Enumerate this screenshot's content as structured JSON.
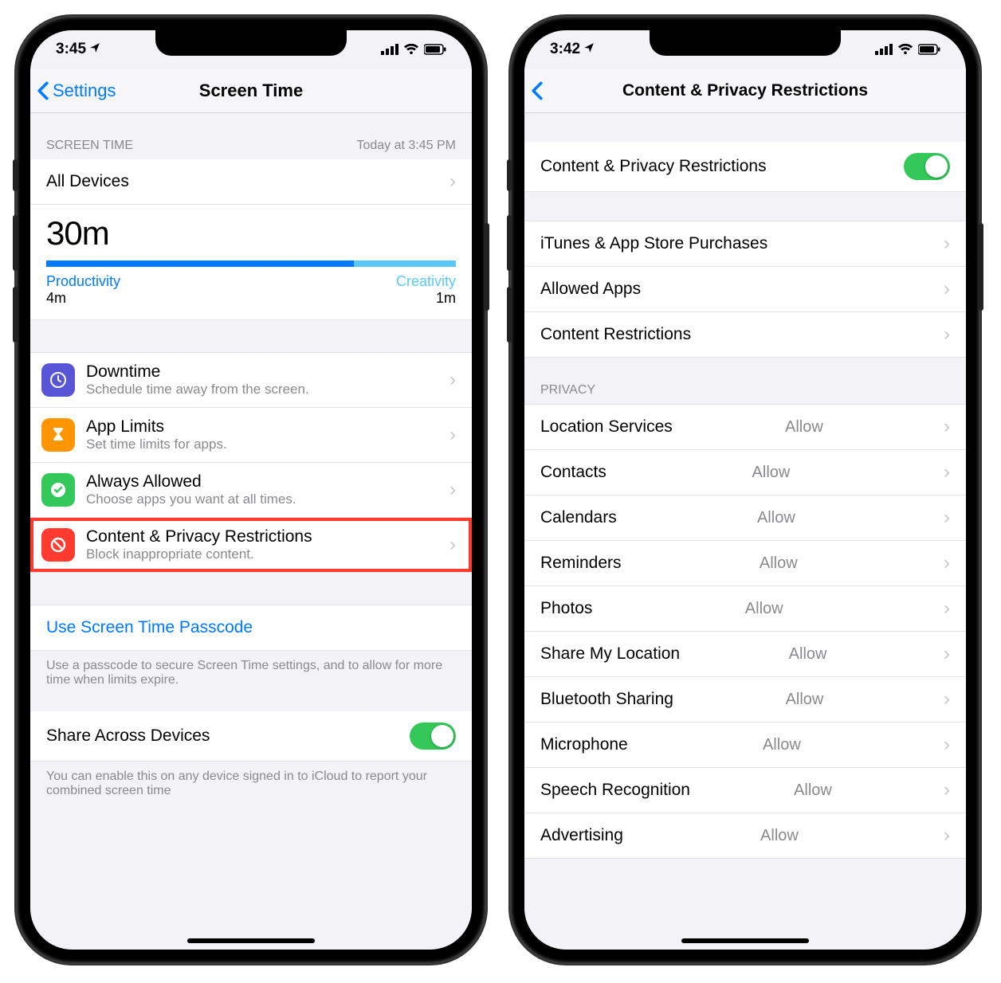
{
  "left": {
    "status": {
      "time": "3:45"
    },
    "nav": {
      "back": "Settings",
      "title": "Screen Time"
    },
    "summary": {
      "header_left": "Screen Time",
      "header_right": "Today at 3:45 PM",
      "all_devices": "All Devices",
      "total_time": "30m",
      "cat1_name": "Productivity",
      "cat1_value": "4m",
      "cat2_name": "Creativity",
      "cat2_value": "1m"
    },
    "features": [
      {
        "title": "Downtime",
        "subtitle": "Schedule time away from the screen.",
        "color": "#5856d6",
        "icon": "clock"
      },
      {
        "title": "App Limits",
        "subtitle": "Set time limits for apps.",
        "color": "#ff9500",
        "icon": "hourglass"
      },
      {
        "title": "Always Allowed",
        "subtitle": "Choose apps you want at all times.",
        "color": "#34c759",
        "icon": "check"
      },
      {
        "title": "Content & Privacy Restrictions",
        "subtitle": "Block inappropriate content.",
        "color": "#ff3b30",
        "icon": "block",
        "highlight": true
      }
    ],
    "passcode": {
      "link": "Use Screen Time Passcode",
      "help": "Use a passcode to secure Screen Time settings, and to allow for more time when limits expire."
    },
    "share": {
      "label": "Share Across Devices",
      "toggle_on": true,
      "help": "You can enable this on any device signed in to iCloud to report your combined screen time"
    }
  },
  "right": {
    "status": {
      "time": "3:42"
    },
    "nav": {
      "title": "Content & Privacy Restrictions"
    },
    "main_toggle": {
      "label": "Content & Privacy Restrictions",
      "on": true
    },
    "group1": [
      "iTunes & App Store Purchases",
      "Allowed Apps",
      "Content Restrictions"
    ],
    "privacy_header": "Privacy",
    "privacy": [
      {
        "label": "Location Services",
        "value": "Allow"
      },
      {
        "label": "Contacts",
        "value": "Allow"
      },
      {
        "label": "Calendars",
        "value": "Allow"
      },
      {
        "label": "Reminders",
        "value": "Allow"
      },
      {
        "label": "Photos",
        "value": "Allow"
      },
      {
        "label": "Share My Location",
        "value": "Allow"
      },
      {
        "label": "Bluetooth Sharing",
        "value": "Allow"
      },
      {
        "label": "Microphone",
        "value": "Allow"
      },
      {
        "label": "Speech Recognition",
        "value": "Allow"
      },
      {
        "label": "Advertising",
        "value": "Allow"
      }
    ]
  }
}
